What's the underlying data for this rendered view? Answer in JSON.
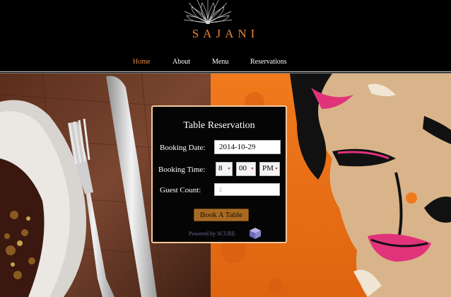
{
  "brand": {
    "name": "SAJANI",
    "accent_color": "#e8863a"
  },
  "nav": {
    "items": [
      {
        "label": "Home",
        "active": true
      },
      {
        "label": "About",
        "active": false
      },
      {
        "label": "Menu",
        "active": false
      },
      {
        "label": "Reservations",
        "active": false
      }
    ]
  },
  "reservation": {
    "title": "Table Reservation",
    "booking_date_label": "Booking Date:",
    "booking_date_value": "2014-10-29",
    "booking_time_label": "Booking Time:",
    "hour": "8",
    "minute": "00",
    "ampm": "PM",
    "guest_count_label": "Guest Count:",
    "guest_count_placeholder": "2",
    "book_button": "Book A Table",
    "powered_by": "Powered by SCUBE",
    "button_color": "#a86a22",
    "border_color": "#f3c99b"
  },
  "icons": {
    "logo": "mandala-icon",
    "scube": "cube-icon",
    "select_caret": "caret-down-icon"
  }
}
